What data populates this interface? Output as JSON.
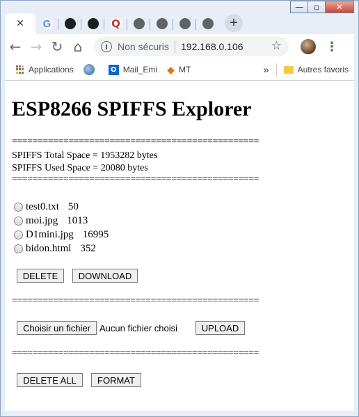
{
  "window": {
    "minimize": "—",
    "maximize": "▫",
    "close": "✕"
  },
  "tabs": [
    {
      "name": "active-tab",
      "glyph": "✕"
    },
    {
      "name": "tab-google",
      "glyph": "G"
    },
    {
      "name": "tab-github-1",
      "glyph": "●"
    },
    {
      "name": "tab-github-2",
      "glyph": "●"
    },
    {
      "name": "tab-q",
      "glyph": "Q"
    },
    {
      "name": "tab-globe-1",
      "glyph": "◉"
    },
    {
      "name": "tab-globe-2",
      "glyph": "◉"
    },
    {
      "name": "tab-globe-3",
      "glyph": "◉"
    },
    {
      "name": "tab-globe-4",
      "glyph": "◉"
    }
  ],
  "toolbar": {
    "security_text": "Non sécurisé",
    "url": "192.168.0.106"
  },
  "bookmarks": {
    "apps": "Applications",
    "item2_label": "",
    "mail": "Mail_Emi",
    "mt": "MT",
    "overflow": "»",
    "other": "Autres favoris"
  },
  "page": {
    "title": "ESP8266 SPIFFS Explorer",
    "separator": "================================================",
    "total_space": "SPIFFS Total Space = 1953282 bytes",
    "used_space": "SPIFFS Used Space = 20080 bytes",
    "files": [
      {
        "name": "test0.txt",
        "size": "50"
      },
      {
        "name": "moi.jpg",
        "size": "1013"
      },
      {
        "name": "D1mini.jpg",
        "size": "16995"
      },
      {
        "name": "bidon.html",
        "size": "352"
      }
    ],
    "delete_btn": "DELETE",
    "download_btn": "DOWNLOAD",
    "choose_file_btn": "Choisir un fichier",
    "no_file": "Aucun fichier choisi",
    "upload_btn": "UPLOAD",
    "delete_all_btn": "DELETE ALL",
    "format_btn": "FORMAT"
  }
}
